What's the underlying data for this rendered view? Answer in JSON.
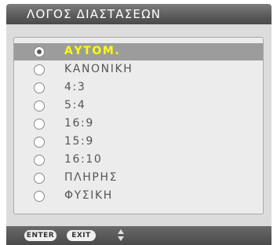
{
  "menu": {
    "title": "ΛΟΓΟΣ ΔΙΑΣΤΑΣΕΩΝ",
    "selected_index": 0,
    "options": [
      {
        "label": "ΑΥΤΟΜ.",
        "checked": true
      },
      {
        "label": "ΚΑΝΟΝΙΚΗ",
        "checked": false
      },
      {
        "label": "4:3",
        "checked": false
      },
      {
        "label": "5:4",
        "checked": false
      },
      {
        "label": "16:9",
        "checked": false
      },
      {
        "label": "15:9",
        "checked": false
      },
      {
        "label": "16:10",
        "checked": false
      },
      {
        "label": "ΠΛΗΡΗΣ",
        "checked": false
      },
      {
        "label": "ΦΥΣΙΚΗ",
        "checked": false
      }
    ]
  },
  "footer": {
    "enter_label": "ENTER",
    "exit_label": "EXIT",
    "updown_icon": "up-down-arrows-icon"
  },
  "colors": {
    "selected_text": "#ffff00",
    "selected_bg": "#9c9c9c",
    "title_bar": "#5d5d5d"
  }
}
